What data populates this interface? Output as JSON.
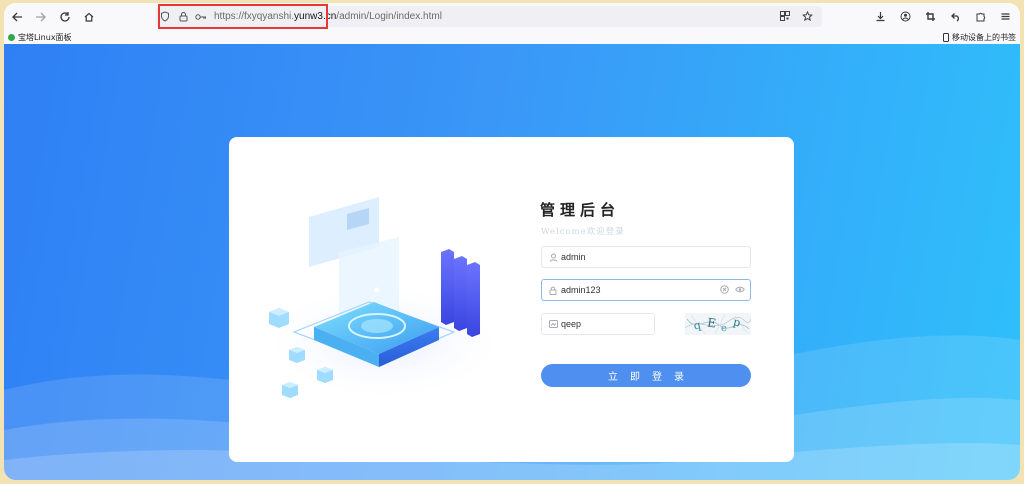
{
  "browser": {
    "url_prefix": "https://fxyqyanshi.",
    "url_host": "yunw3.cn",
    "url_path": "/admin/Login/index.html"
  },
  "bookmarks": {
    "left_item": "宝塔Linux面板",
    "right_item": "移动设备上的书签"
  },
  "login": {
    "title": "管理后台",
    "subtitle": "Welcome欢迎登录",
    "username_value": "admin",
    "password_value": "admin123",
    "captcha_value": "qeep",
    "captcha_image_text": "qEep",
    "button_label": "立即登录"
  },
  "colors": {
    "accent": "#4f8ff0",
    "page_gradient_start": "#2f80f4",
    "page_gradient_end": "#2fc0fb",
    "highlight": "#e53935"
  },
  "icons": {
    "back": "back-arrow-icon",
    "forward": "forward-arrow-icon",
    "reload": "reload-icon",
    "home": "home-icon",
    "shield": "shield-icon",
    "lock": "lock-icon",
    "key": "key-icon",
    "qr": "qr-code-icon",
    "star": "bookmark-star-icon",
    "download": "download-icon",
    "account": "account-icon",
    "crop": "screenshot-icon",
    "undo": "undo-icon",
    "extensions": "extensions-icon",
    "menu": "menu-icon"
  }
}
